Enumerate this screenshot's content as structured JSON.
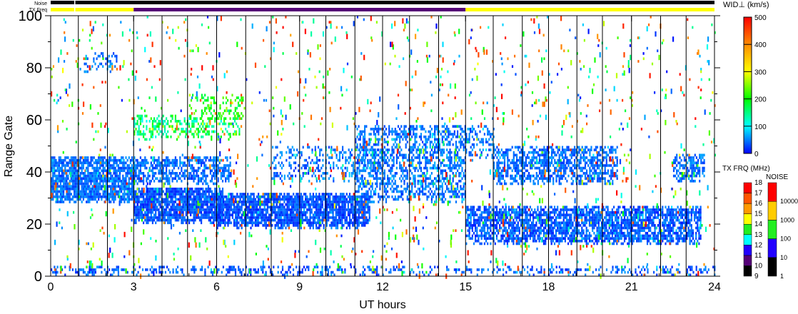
{
  "chart_data": {
    "type": "heatmap",
    "title": "",
    "xlabel": "UT hours",
    "ylabel": "Range Gate",
    "xlim": [
      0,
      24
    ],
    "ylim": [
      0,
      100
    ],
    "x_ticks": [
      "0",
      "3",
      "6",
      "9",
      "12",
      "15",
      "18",
      "21",
      "24"
    ],
    "y_ticks": [
      "0",
      "20",
      "40",
      "60",
      "80",
      "100"
    ],
    "top_bars": {
      "noise_label": "Noise",
      "txfreq_label": "TX Freq",
      "txfreq_segments": [
        {
          "start": 0,
          "end": 3,
          "color": "#ffff00"
        },
        {
          "start": 3,
          "end": 15,
          "color": "#550077"
        },
        {
          "start": 15,
          "end": 24,
          "color": "#ffff00"
        }
      ]
    },
    "echo_regions": [
      {
        "t": [
          0,
          3
        ],
        "gates": [
          28,
          46
        ],
        "density": 0.85,
        "width": [
          20,
          90
        ]
      },
      {
        "t": [
          1.2,
          2.4
        ],
        "gates": [
          78,
          86
        ],
        "density": 0.35,
        "width": [
          20,
          90
        ]
      },
      {
        "t": [
          3,
          6.2
        ],
        "gates": [
          20,
          34
        ],
        "density": 0.9,
        "width": [
          10,
          80
        ]
      },
      {
        "t": [
          3,
          6.5
        ],
        "gates": [
          35,
          46
        ],
        "density": 0.6,
        "width": [
          20,
          90
        ]
      },
      {
        "t": [
          3,
          6.8
        ],
        "gates": [
          52,
          62
        ],
        "density": 0.4,
        "width": [
          100,
          320
        ]
      },
      {
        "t": [
          5,
          7
        ],
        "gates": [
          60,
          70
        ],
        "density": 0.25,
        "width": [
          150,
          300
        ]
      },
      {
        "t": [
          6,
          11.5
        ],
        "gates": [
          18,
          32
        ],
        "density": 0.85,
        "width": [
          10,
          80
        ]
      },
      {
        "t": [
          8,
          12
        ],
        "gates": [
          36,
          50
        ],
        "density": 0.3,
        "width": [
          20,
          100
        ]
      },
      {
        "t": [
          11,
          15
        ],
        "gates": [
          28,
          58
        ],
        "density": 0.45,
        "width": [
          20,
          100
        ]
      },
      {
        "t": [
          15,
          16
        ],
        "gates": [
          44,
          58
        ],
        "density": 0.4,
        "width": [
          20,
          100
        ]
      },
      {
        "t": [
          15,
          23.5
        ],
        "gates": [
          12,
          27
        ],
        "density": 0.75,
        "width": [
          10,
          90
        ]
      },
      {
        "t": [
          16,
          20.5
        ],
        "gates": [
          35,
          50
        ],
        "density": 0.6,
        "width": [
          20,
          90
        ]
      },
      {
        "t": [
          22.5,
          23.6
        ],
        "gates": [
          36,
          47
        ],
        "density": 0.55,
        "width": [
          20,
          90
        ]
      },
      {
        "t": [
          0,
          24
        ],
        "gates": [
          0,
          4
        ],
        "density": 0.35,
        "width": [
          10,
          90
        ]
      }
    ],
    "width_colorbar": {
      "label": "WID⊥ (km/s)",
      "ticks": [
        "0",
        "100",
        "200",
        "300",
        "400",
        "500"
      ],
      "range": [
        0,
        500
      ]
    },
    "txfreq_colorbar": {
      "label": "TX FRQ (MHz)",
      "ticks": [
        "9",
        "10",
        "11",
        "12",
        "13",
        "14",
        "15",
        "16",
        "17",
        "18"
      ],
      "colors": [
        "#000000",
        "#550077",
        "#2200ff",
        "#00ffff",
        "#22ee22",
        "#ffff00",
        "#ff9900",
        "#ff5500",
        "#ff0000"
      ]
    },
    "noise_colorbar": {
      "label": "NOISE",
      "ticks": [
        "1",
        "10",
        "100",
        "1000",
        "10000"
      ],
      "colors": [
        "#000000",
        "#2200ff",
        "#22ee22",
        "#ffcc00",
        "#ff0000"
      ]
    }
  }
}
